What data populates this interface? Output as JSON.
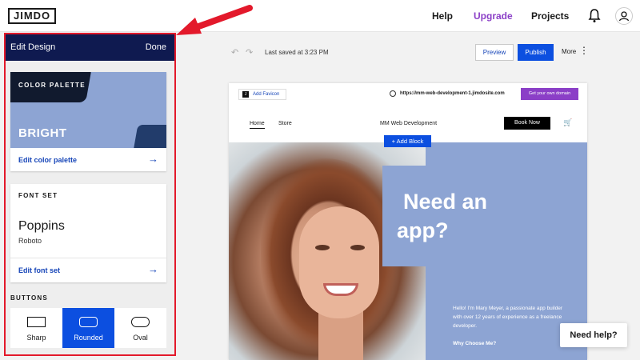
{
  "topbar": {
    "logo": "JIMDO",
    "help": "Help",
    "upgrade": "Upgrade",
    "projects": "Projects",
    "icons": {
      "bell": "bell-icon",
      "user": "user-icon"
    },
    "upgrade_color": "#8b3fc7"
  },
  "sidebar": {
    "title": "Edit Design",
    "done": "Done",
    "header_color": "#0f1a50",
    "palette": {
      "label": "COLOR PALETTE",
      "name": "BRIGHT",
      "link": "Edit color palette",
      "colors": [
        "#8da4d3",
        "#111a2e",
        "#223c6b"
      ]
    },
    "fontset": {
      "label": "FONT SET",
      "primary": "Poppins",
      "secondary": "Roboto",
      "link": "Edit font set"
    },
    "buttons": {
      "label": "BUTTONS",
      "options": [
        "Sharp",
        "Rounded",
        "Oval"
      ],
      "selected": "Rounded"
    }
  },
  "toolbar": {
    "last_saved": "Last saved at 3:23 PM",
    "preview": "Preview",
    "publish": "Publish",
    "more": "More",
    "accent": "#0c4fe0"
  },
  "site": {
    "add_favicon": "Add Favicon",
    "url": "https://mm-web-development-1.jimdosite.com",
    "get_domain": "Get your own domain",
    "nav": [
      "Home",
      "Store"
    ],
    "site_title": "MM Web Development",
    "book_now": "Book Now",
    "add_block": "Add Block",
    "headline_line1": "Need an",
    "headline_line2": "app?",
    "bio": "Hello! I'm Mary Meyer, a passionate app builder with over 12 years of experience as a freelance developer.",
    "why": "Why Choose Me?",
    "hero_color": "#8da4d3"
  },
  "help_widget": {
    "label": "Need help?"
  },
  "annotation": {
    "color": "#e3192b"
  }
}
